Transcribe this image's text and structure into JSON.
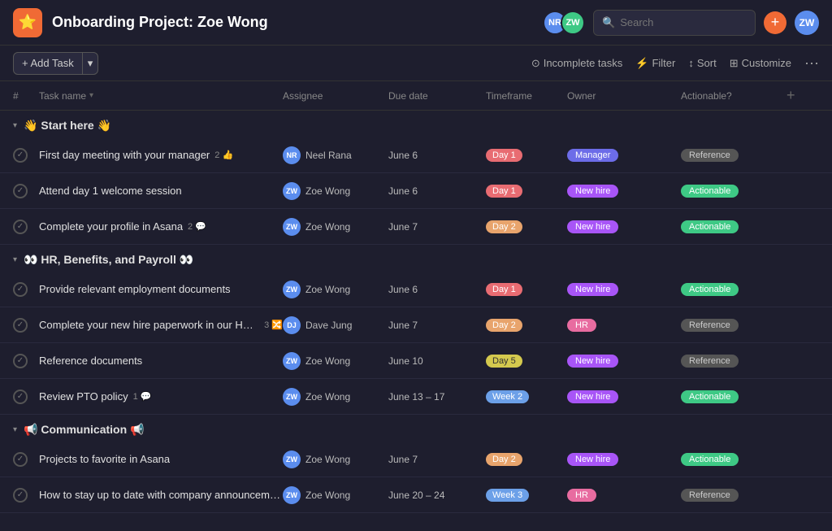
{
  "header": {
    "app_icon": "⭐",
    "title": "Onboarding Project: Zoe Wong",
    "search_placeholder": "Search",
    "add_button": "+",
    "avatars": [
      {
        "initials": "NR",
        "color": "blue"
      },
      {
        "initials": "ZW",
        "color": "green"
      }
    ]
  },
  "toolbar": {
    "add_task_label": "+ Add Task",
    "arrow": "▾",
    "filter_status": "Incomplete tasks",
    "filter_label": "Filter",
    "sort_label": "Sort",
    "customize_label": "Customize",
    "more": "···"
  },
  "columns": [
    {
      "id": "num",
      "label": "#"
    },
    {
      "id": "task",
      "label": "Task name"
    },
    {
      "id": "assignee",
      "label": "Assignee"
    },
    {
      "id": "due",
      "label": "Due date"
    },
    {
      "id": "timeframe",
      "label": "Timeframe"
    },
    {
      "id": "owner",
      "label": "Owner"
    },
    {
      "id": "actionable",
      "label": "Actionable?"
    }
  ],
  "sections": [
    {
      "id": "start-here",
      "title": "👋 Start here 👋",
      "tasks": [
        {
          "name": "First day meeting with your manager",
          "badges": [
            "2 👍"
          ],
          "assignee": "Neel Rana",
          "assignee_initials": "NR",
          "assignee_color": "blue",
          "due": "June 6",
          "timeframe": "Day 1",
          "timeframe_class": "tf-day1",
          "owner": "Manager",
          "owner_class": "owner-manager",
          "actionable": "Reference",
          "actionable_class": "act-reference"
        },
        {
          "name": "Attend day 1 welcome session",
          "badges": [],
          "assignee": "Zoe Wong",
          "assignee_initials": "ZW",
          "assignee_color": "green",
          "due": "June 6",
          "timeframe": "Day 1",
          "timeframe_class": "tf-day1",
          "owner": "New hire",
          "owner_class": "owner-newhire",
          "actionable": "Actionable",
          "actionable_class": "act-actionable"
        },
        {
          "name": "Complete your profile in Asana",
          "badges": [
            "2 💬"
          ],
          "assignee": "Zoe Wong",
          "assignee_initials": "ZW",
          "assignee_color": "green",
          "due": "June 7",
          "timeframe": "Day 2",
          "timeframe_class": "tf-day2",
          "owner": "New hire",
          "owner_class": "owner-newhire",
          "actionable": "Actionable",
          "actionable_class": "act-actionable"
        }
      ]
    },
    {
      "id": "hr-benefits",
      "title": "👀 HR, Benefits, and Payroll 👀",
      "tasks": [
        {
          "name": "Provide relevant employment documents",
          "badges": [],
          "assignee": "Zoe Wong",
          "assignee_initials": "ZW",
          "assignee_color": "green",
          "due": "June 6",
          "timeframe": "Day 1",
          "timeframe_class": "tf-day1",
          "owner": "New hire",
          "owner_class": "owner-newhire",
          "actionable": "Actionable",
          "actionable_class": "act-actionable"
        },
        {
          "name": "Complete your new hire paperwork in our HRIS",
          "badges": [
            "3 🔀"
          ],
          "assignee": "Dave Jung",
          "assignee_initials": "DJ",
          "assignee_color": "purple",
          "due": "June 7",
          "timeframe": "Day 2",
          "timeframe_class": "tf-day2",
          "owner": "HR",
          "owner_class": "owner-hr",
          "actionable": "Reference",
          "actionable_class": "act-reference"
        },
        {
          "name": "Reference documents",
          "badges": [],
          "assignee": "Zoe Wong",
          "assignee_initials": "ZW",
          "assignee_color": "green",
          "due": "June 10",
          "timeframe": "Day 5",
          "timeframe_class": "tf-day5",
          "owner": "New hire",
          "owner_class": "owner-newhire",
          "actionable": "Reference",
          "actionable_class": "act-reference"
        },
        {
          "name": "Review PTO policy",
          "badges": [
            "1 💬"
          ],
          "assignee": "Zoe Wong",
          "assignee_initials": "ZW",
          "assignee_color": "green",
          "due": "June 13 – 17",
          "timeframe": "Week 2",
          "timeframe_class": "tf-week2",
          "owner": "New hire",
          "owner_class": "owner-newhire",
          "actionable": "Actionable",
          "actionable_class": "act-actionable"
        }
      ]
    },
    {
      "id": "communication",
      "title": "📢 Communication 📢",
      "tasks": [
        {
          "name": "Projects to favorite in Asana",
          "badges": [],
          "assignee": "Zoe Wong",
          "assignee_initials": "ZW",
          "assignee_color": "green",
          "due": "June 7",
          "timeframe": "Day 2",
          "timeframe_class": "tf-day2",
          "owner": "New hire",
          "owner_class": "owner-newhire",
          "actionable": "Actionable",
          "actionable_class": "act-actionable"
        },
        {
          "name": "How to stay up to date with company announcements",
          "badges": [],
          "assignee": "Zoe Wong",
          "assignee_initials": "ZW",
          "assignee_color": "green",
          "due": "June 20 – 24",
          "timeframe": "Week 3",
          "timeframe_class": "tf-week3",
          "owner": "HR",
          "owner_class": "owner-hr",
          "actionable": "Reference",
          "actionable_class": "act-reference"
        }
      ]
    }
  ]
}
